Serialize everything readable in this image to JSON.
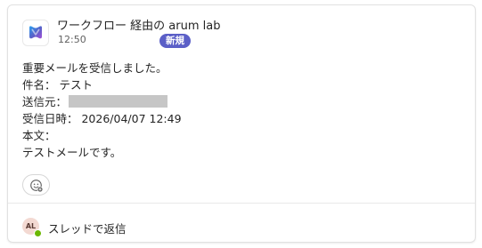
{
  "message": {
    "sender": "ワークフロー 経由の arum lab",
    "time": "12:50",
    "badge": "新規",
    "body_lines": [
      "重要メールを受信しました。",
      "件名： テスト",
      "送信元：",
      "受信日時： 2026/04/07 12:49",
      "本文：",
      "テストメールです。"
    ],
    "logo_icon": "workflow-app-icon",
    "react_icon": "add-reaction-icon"
  },
  "reply": {
    "avatar_initials": "AL",
    "label": "スレッドで返信"
  },
  "colors": {
    "badge": "#5b5fc7",
    "presence": "#6bb700",
    "redaction": "#c6c6c6"
  }
}
